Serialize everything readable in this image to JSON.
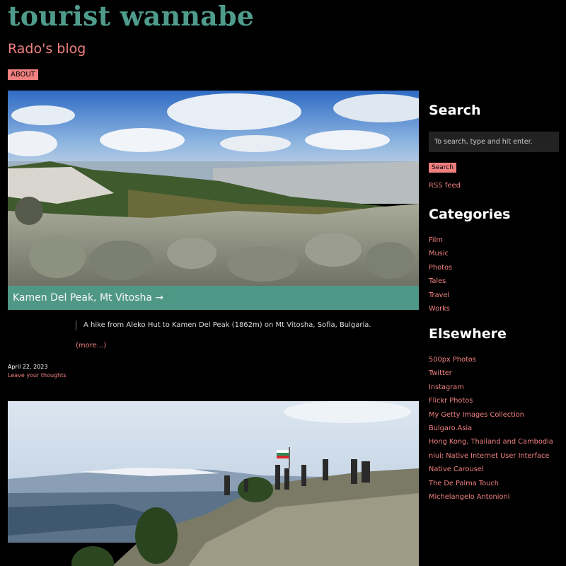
{
  "header": {
    "site_title": "tourist wannabe",
    "subtitle": "Rado's blog",
    "nav": {
      "about_label": "ABOUT"
    }
  },
  "posts": [
    {
      "title": "Kamen Del Peak, Mt Vitosha →",
      "excerpt": "A hike from Aleko Hut to Kamen Del Peak (1862m) on Mt Vitosha, Sofia, Bulgaria.",
      "more_label": "(more...)",
      "date": "April 22, 2023",
      "comments_label": "Leave your thoughts"
    }
  ],
  "sidebar": {
    "search": {
      "title": "Search",
      "placeholder": "To search, type and hit enter.",
      "button_label": "Search",
      "rss_label": "RSS feed"
    },
    "categories": {
      "title": "Categories",
      "items": [
        "Film",
        "Music",
        "Photos",
        "Tales",
        "Travel",
        "Works"
      ]
    },
    "elsewhere": {
      "title": "Elsewhere",
      "items": [
        "500px Photos",
        "Twitter",
        "Instagram",
        "Flickr Photos",
        "My Getty Images Collection",
        "Bulgaro.Asia",
        "Hong Kong, Thailand and Cambodia",
        "niui: Native Internet User Interface",
        "Native Carousel",
        "The De Palma Touch",
        "Michelangelo Antonioni"
      ]
    }
  },
  "colors": {
    "background": "#000000",
    "title_teal": "#4f9c8c",
    "accent_salmon": "#f08080"
  }
}
